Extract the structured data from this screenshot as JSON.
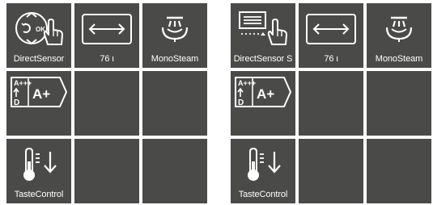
{
  "left_panel": {
    "row1": {
      "sensor_label": "DirectSensor",
      "sensor_ok_text": "OK",
      "width_label": "76 ι",
      "steam_label": "MonoSteam"
    },
    "row2": {
      "energy_scale_top": "A+++",
      "energy_scale_bottom": "D",
      "energy_class": "A+"
    },
    "row3": {
      "taste_label": "TasteControl"
    }
  },
  "right_panel": {
    "row1": {
      "sensor_label": "DirectSensor S",
      "width_label": "76 ι",
      "steam_label": "MonoSteam"
    },
    "row2": {
      "energy_scale_top": "A+++",
      "energy_scale_bottom": "D",
      "energy_class": "A+"
    },
    "row3": {
      "taste_label": "TasteControl"
    }
  },
  "colors": {
    "tile_background": "#4a4a48",
    "icon_and_text": "#ffffff",
    "page_background": "#ffffff"
  }
}
